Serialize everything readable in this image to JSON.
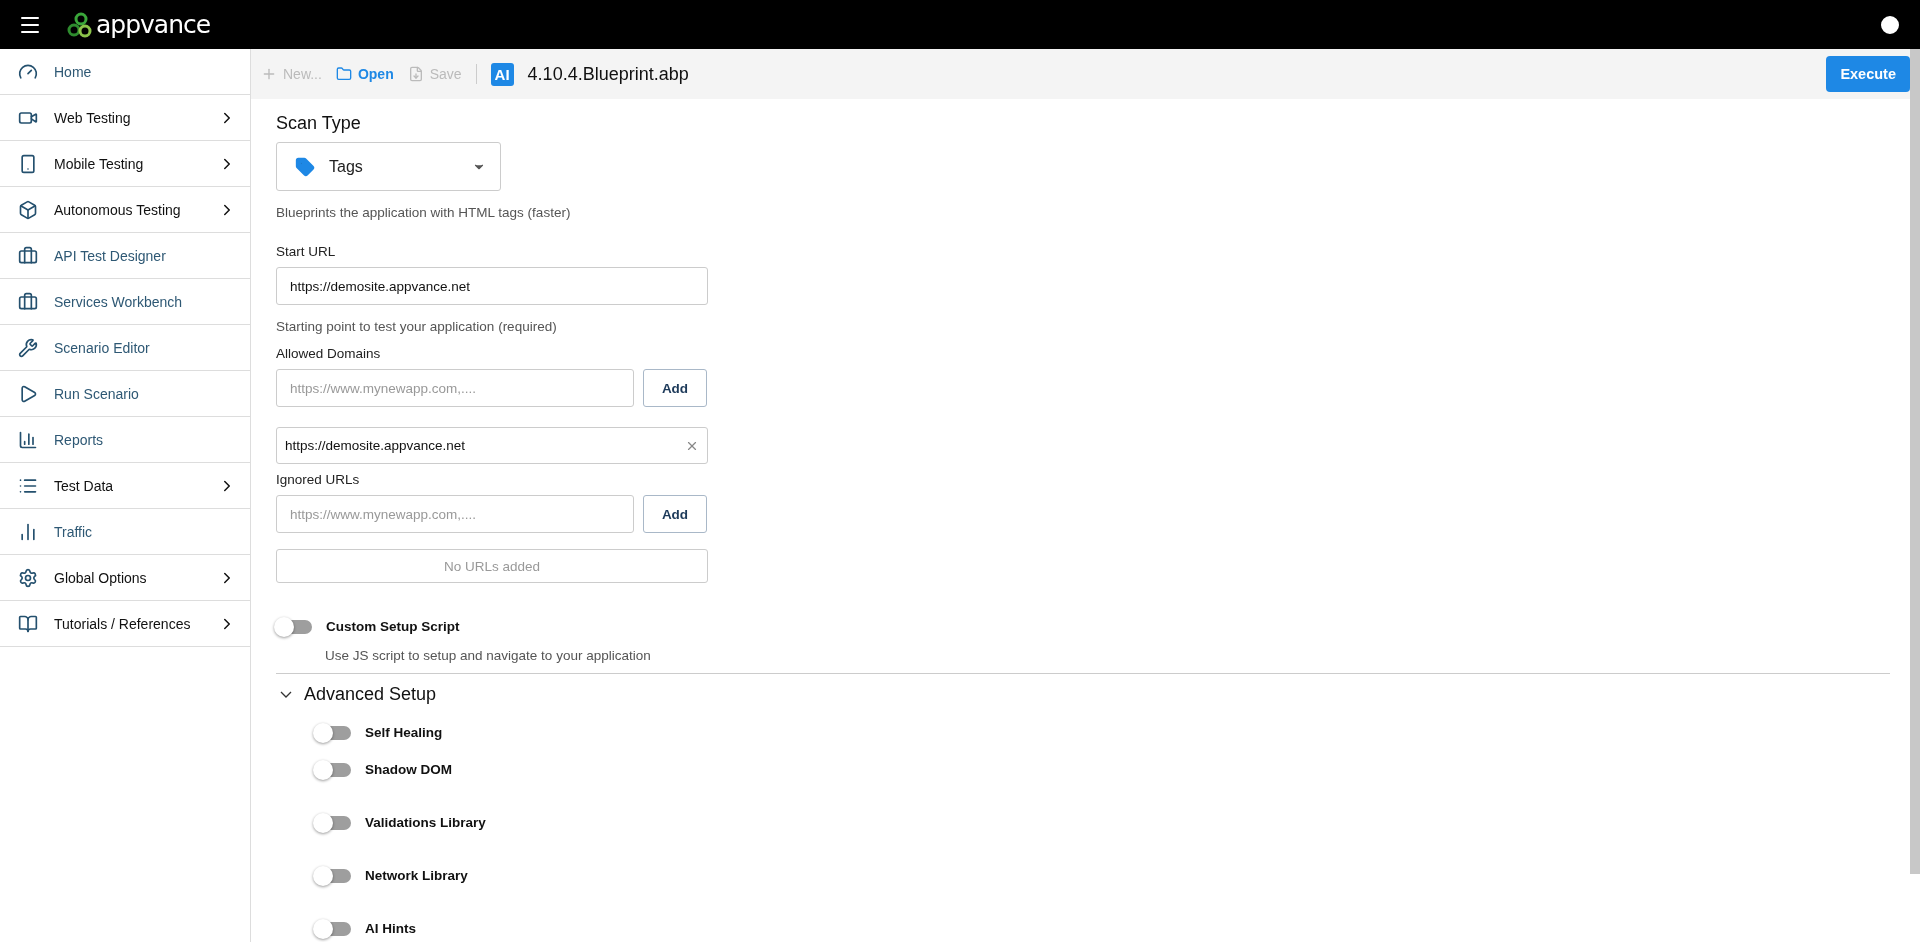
{
  "header": {
    "logo_text": "appvance"
  },
  "sidebar": {
    "items": [
      {
        "label": "Home",
        "has_children": false
      },
      {
        "label": "Web Testing",
        "has_children": true
      },
      {
        "label": "Mobile Testing",
        "has_children": true
      },
      {
        "label": "Autonomous Testing",
        "has_children": true
      },
      {
        "label": "API Test Designer",
        "has_children": false
      },
      {
        "label": "Services Workbench",
        "has_children": false
      },
      {
        "label": "Scenario Editor",
        "has_children": false
      },
      {
        "label": "Run Scenario",
        "has_children": false
      },
      {
        "label": "Reports",
        "has_children": false
      },
      {
        "label": "Test Data",
        "has_children": true
      },
      {
        "label": "Traffic",
        "has_children": false
      },
      {
        "label": "Global Options",
        "has_children": true
      },
      {
        "label": "Tutorials / References",
        "has_children": true
      }
    ]
  },
  "toolbar": {
    "actions": [
      {
        "label": "New...",
        "disabled": true
      },
      {
        "label": "Open",
        "disabled": false
      },
      {
        "label": "Save",
        "disabled": true
      }
    ],
    "file_badge": "AI",
    "file_name": "4.10.4.Blueprint.abp",
    "execute": "Execute"
  },
  "form": {
    "scan_type": {
      "title": "Scan Type",
      "value": "Tags",
      "hint": "Blueprints the application with HTML tags (faster)"
    },
    "start_url": {
      "label": "Start URL",
      "value": "https://demosite.appvance.net",
      "hint": "Starting point to test your application (required)"
    },
    "allowed_domains": {
      "label": "Allowed Domains",
      "placeholder": "https://www.mynewapp.com,....",
      "add": "Add",
      "entries": [
        "https://demosite.appvance.net"
      ]
    },
    "ignored_urls": {
      "label": "Ignored URLs",
      "placeholder": "https://www.mynewapp.com,....",
      "add": "Add",
      "empty": "No URLs added"
    },
    "custom_setup": {
      "label": "Custom Setup Script",
      "on": false,
      "hint": "Use JS script to setup and navigate to your application"
    }
  },
  "advanced": {
    "title": "Advanced Setup",
    "expanded": true,
    "toggles": [
      {
        "label": "Self Healing",
        "on": false
      },
      {
        "label": "Shadow DOM",
        "on": false
      },
      {
        "label": "Validations Library",
        "on": false
      },
      {
        "label": "Network Library",
        "on": false
      },
      {
        "label": "AI Hints",
        "on": false
      }
    ]
  }
}
